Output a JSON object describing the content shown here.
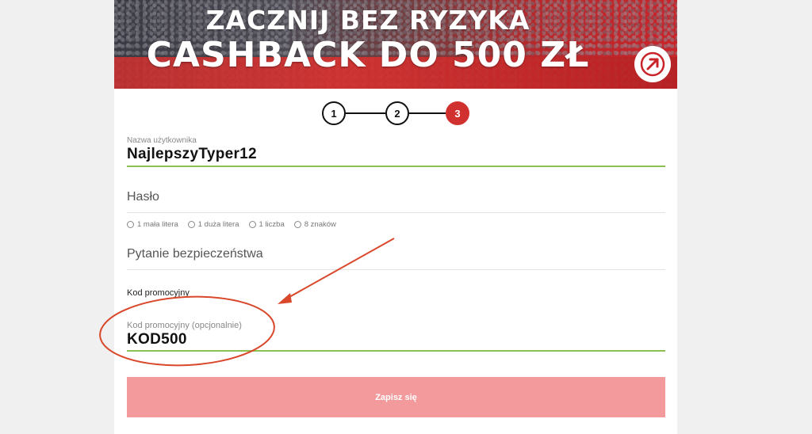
{
  "banner": {
    "line1": "ZACZNIJ BEZ RYZYKA",
    "line2": "CASHBACK DO 500 ZŁ",
    "arrow_icon": "arrow-up-right-icon"
  },
  "steps": {
    "items": [
      "1",
      "2",
      "3"
    ],
    "active_index": 3,
    "active_color": "#d0302e"
  },
  "form": {
    "username": {
      "label": "Nazwa użytkownika",
      "value": "NajlepszyTyper12"
    },
    "password": {
      "placeholder": "Hasło",
      "requirements": [
        "1 mała litera",
        "1 duża litera",
        "1 liczba",
        "8 znaków"
      ]
    },
    "security_question": {
      "placeholder": "Pytanie bezpieczeństwa"
    },
    "promo": {
      "heading": "Kod promocyjny",
      "label": "Kod promocyjny (opcjonalnie)",
      "value": "KOD500"
    },
    "submit_label": "Zapisz się"
  },
  "colors": {
    "valid_line": "#8cc152",
    "submit_bg": "#f29a9c",
    "annotation": "#d9482b"
  }
}
